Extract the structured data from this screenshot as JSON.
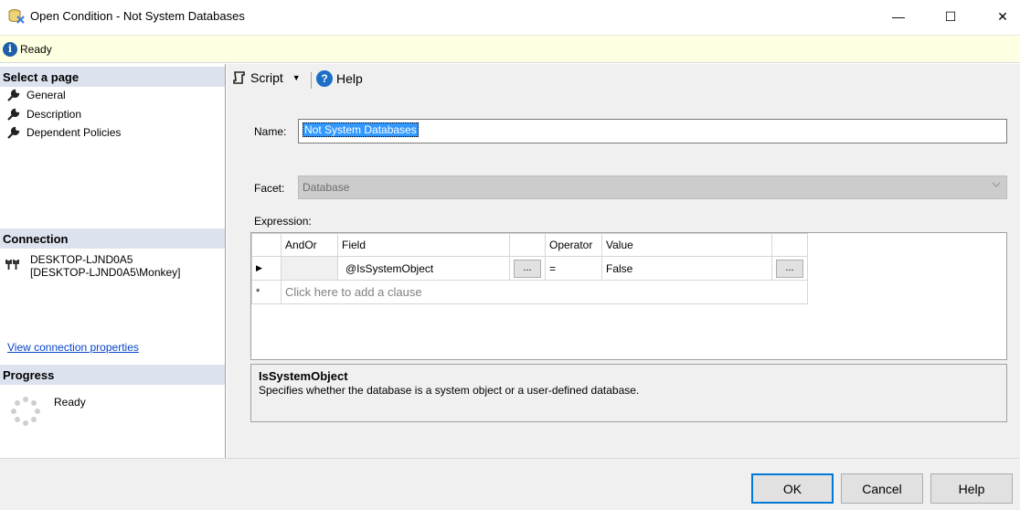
{
  "window": {
    "title": "Open Condition - Not System Databases",
    "minimize_glyph": "—",
    "maximize_glyph": "☐",
    "close_glyph": "✕"
  },
  "status": {
    "icon": "info-icon",
    "text": "Ready"
  },
  "left": {
    "select_page_header": "Select a page",
    "pages": [
      {
        "label": "General",
        "icon": "wrench-icon"
      },
      {
        "label": "Description",
        "icon": "wrench-icon"
      },
      {
        "label": "Dependent Policies",
        "icon": "wrench-icon"
      }
    ],
    "connection_header": "Connection",
    "connection_line1": "DESKTOP-LJND0A5",
    "connection_line2": "[DESKTOP-LJND0A5\\Monkey]",
    "view_connection_link": "View connection properties",
    "progress_header": "Progress",
    "progress_text": "Ready"
  },
  "toolbar": {
    "script_label": "Script",
    "help_label": "Help"
  },
  "form": {
    "name_label": "Name:",
    "name_value": "Not System Databases",
    "facet_label": "Facet:",
    "facet_value": "Database",
    "expression_label": "Expression:"
  },
  "grid": {
    "headers": {
      "andor": "AndOr",
      "field": "Field",
      "operator": "Operator",
      "value": "Value"
    },
    "rows": [
      {
        "indicator": "▶",
        "andor": "",
        "field": "@IsSystemObject",
        "field_btn": "...",
        "operator": "=",
        "value": "False",
        "value_btn": "..."
      }
    ],
    "new_row_indicator": "*",
    "new_row_text": "Click here to add a clause"
  },
  "description": {
    "title": "IsSystemObject",
    "body": "Specifies whether the database is a system object or a user-defined database."
  },
  "buttons": {
    "ok": "OK",
    "cancel": "Cancel",
    "help": "Help"
  },
  "colors": {
    "section_header": "#dde3ee",
    "status_bg": "#ffffe1",
    "accent": "#0078d7",
    "link": "#0645c8"
  }
}
